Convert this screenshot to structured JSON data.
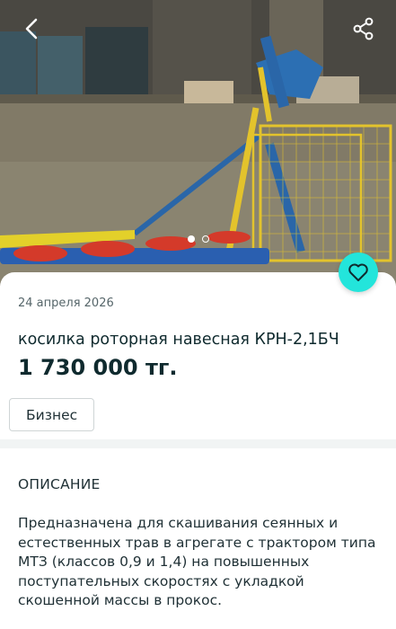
{
  "listing": {
    "date": "24 апреля 2026",
    "title": "косилка роторная навесная КРН-2,1БЧ",
    "price": "1 730 000 тг.",
    "badge": "Бизнес"
  },
  "description": {
    "heading": "ОПИСАНИЕ",
    "text": "Предназначена для скашивания сеянных и естественных трав в агрегате с трактором типа МТЗ (классов 0,9 и 1,4) на повышенных поступательных скоростях с укладкой скошенной массы в прокос."
  },
  "gallery": {
    "photo_count": 2,
    "active_index": 0
  },
  "icons": {
    "back": "chevron-left-icon",
    "share": "share-icon",
    "favorite": "heart-icon"
  },
  "colors": {
    "accent": "#23e5db",
    "text": "#1f3035",
    "divider": "#f1f4f4"
  }
}
